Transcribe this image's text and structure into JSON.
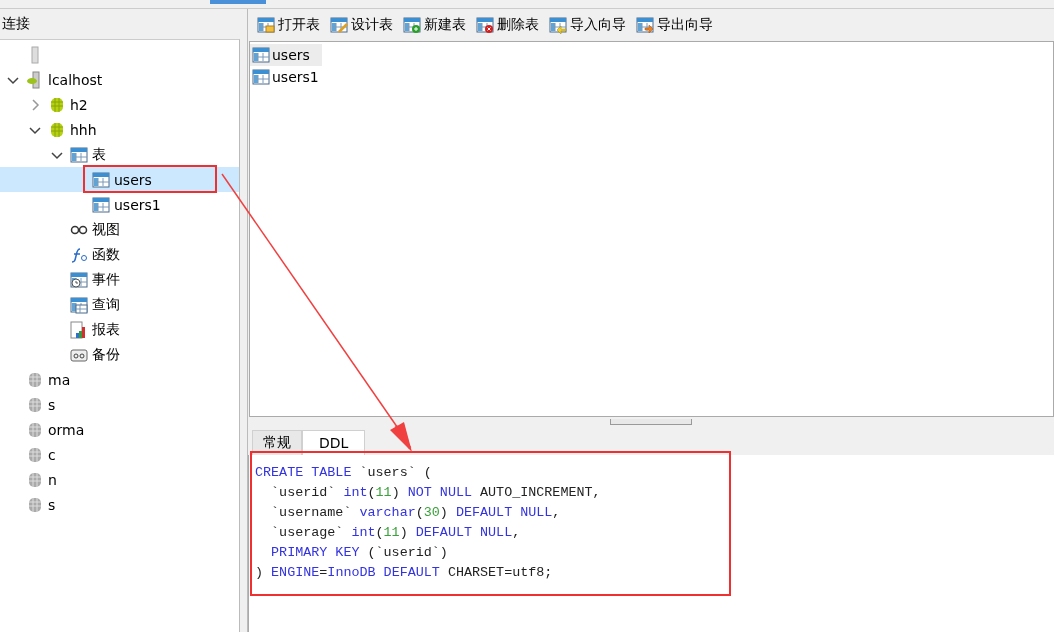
{
  "sidebar": {
    "title": "连接",
    "tree": [
      {
        "kind": "server",
        "selected": false
      },
      {
        "label": "lcalhost",
        "kind": "connection",
        "expanded": true,
        "selected": false,
        "children": [
          {
            "label": "h2",
            "kind": "database-open",
            "expanded": false,
            "selected": false
          },
          {
            "label": "hhh",
            "kind": "database-open",
            "expanded": true,
            "selected": false,
            "children": [
              {
                "label": "表",
                "kind": "tables",
                "expanded": true,
                "selected": false,
                "children": [
                  {
                    "label": "users",
                    "kind": "table",
                    "selected": true
                  },
                  {
                    "label": "users1",
                    "kind": "table",
                    "selected": false
                  }
                ]
              },
              {
                "label": "视图",
                "kind": "views",
                "selected": false
              },
              {
                "label": "函数",
                "kind": "functions",
                "selected": false
              },
              {
                "label": "事件",
                "kind": "events",
                "selected": false
              },
              {
                "label": "查询",
                "kind": "queries",
                "selected": false
              },
              {
                "label": "报表",
                "kind": "reports",
                "selected": false
              },
              {
                "label": "备份",
                "kind": "backups",
                "selected": false
              }
            ]
          }
        ]
      },
      {
        "label": "ma",
        "kind": "database",
        "selected": false
      },
      {
        "label": "s",
        "kind": "database",
        "selected": false
      },
      {
        "label": "orma",
        "kind": "database",
        "selected": false
      },
      {
        "label": "c",
        "kind": "database",
        "selected": false
      },
      {
        "label": "n",
        "kind": "database",
        "selected": false
      },
      {
        "label": "s",
        "kind": "database",
        "selected": false
      }
    ]
  },
  "toolbar": [
    {
      "label": "打开表",
      "kind": "open"
    },
    {
      "label": "设计表",
      "kind": "design"
    },
    {
      "label": "新建表",
      "kind": "new"
    },
    {
      "label": "删除表",
      "kind": "delete"
    },
    {
      "label": "导入向导",
      "kind": "import"
    },
    {
      "label": "导出向导",
      "kind": "export"
    }
  ],
  "objects": [
    {
      "label": "users",
      "selected": true
    },
    {
      "label": "users1",
      "selected": false
    }
  ],
  "tabs": [
    {
      "label": "常规",
      "selected": false
    },
    {
      "label": "DDL",
      "selected": true
    }
  ],
  "ddl": [
    {
      "indent": false,
      "tokens": [
        {
          "t": "CREATE TABLE",
          "kind": "keyword"
        },
        {
          "t": " `users` (",
          "kind": "plain"
        }
      ]
    },
    {
      "indent": true,
      "tokens": [
        {
          "t": "`userid` ",
          "kind": "plain"
        },
        {
          "t": "int",
          "kind": "keyword"
        },
        {
          "t": "(",
          "kind": "plain"
        },
        {
          "t": "11",
          "kind": "number"
        },
        {
          "t": ") ",
          "kind": "plain"
        },
        {
          "t": "NOT NULL",
          "kind": "keyword"
        },
        {
          "t": " AUTO_INCREMENT,",
          "kind": "plain"
        }
      ]
    },
    {
      "indent": true,
      "tokens": [
        {
          "t": "`username` ",
          "kind": "plain"
        },
        {
          "t": "varchar",
          "kind": "keyword"
        },
        {
          "t": "(",
          "kind": "plain"
        },
        {
          "t": "30",
          "kind": "number"
        },
        {
          "t": ") ",
          "kind": "plain"
        },
        {
          "t": "DEFAULT NULL",
          "kind": "keyword"
        },
        {
          "t": ",",
          "kind": "plain"
        }
      ]
    },
    {
      "indent": true,
      "tokens": [
        {
          "t": "`userage` ",
          "kind": "plain"
        },
        {
          "t": "int",
          "kind": "keyword"
        },
        {
          "t": "(",
          "kind": "plain"
        },
        {
          "t": "11",
          "kind": "number"
        },
        {
          "t": ") ",
          "kind": "plain"
        },
        {
          "t": "DEFAULT NULL",
          "kind": "keyword"
        },
        {
          "t": ",",
          "kind": "plain"
        }
      ]
    },
    {
      "indent": true,
      "tokens": [
        {
          "t": "PRIMARY KEY",
          "kind": "keyword"
        },
        {
          "t": " (`userid`)",
          "kind": "plain"
        }
      ]
    },
    {
      "indent": false,
      "tokens": [
        {
          "t": ") ",
          "kind": "plain"
        },
        {
          "t": "ENGINE",
          "kind": "keyword"
        },
        {
          "t": "=",
          "kind": "plain"
        },
        {
          "t": "InnoDB DEFAULT",
          "kind": "keyword"
        },
        {
          "t": " CHARSET=utf8;",
          "kind": "plain"
        }
      ]
    }
  ]
}
